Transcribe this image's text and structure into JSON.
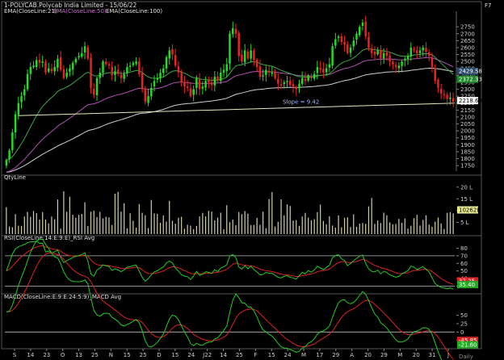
{
  "header": {
    "title": "1-POLYCAB.Polycab India Limited - 15/06/22",
    "ema_legend": [
      {
        "label": "EMA(CloseLine:21)",
        "color": "#e0e0e0"
      },
      {
        "label": "EMA(CloseLine:50)",
        "color": "#d070d0"
      },
      {
        "label": "EMA(CloseLine:100)",
        "color": "#e0e0e0"
      }
    ],
    "corner_label": "F7"
  },
  "colors": {
    "up": "#22dd22",
    "down": "#ee2222",
    "ema21": "#3aa84a",
    "ema50": "#b050b0",
    "ema100": "#cfcfcf",
    "rsi": "#22cc22",
    "rsi_avg": "#dd2222",
    "volume": "#cfcfaa"
  },
  "chart_data": [
    {
      "type": "candlestick",
      "title": "1-POLYCAB.Polycab India Limited - 15/06/22",
      "y_ticks": [
        2750,
        2700,
        2650,
        2600,
        2550,
        2500,
        2450,
        2400,
        2350,
        2300,
        2250,
        2200,
        2150,
        2100,
        2050,
        2000,
        1950,
        1900,
        1850,
        1800,
        1750
      ],
      "ylim": [
        1710,
        2815
      ],
      "x_tick_labels": [
        "S",
        "14",
        "23",
        "O",
        "13",
        "25",
        "N",
        "15",
        "25",
        "D",
        "15",
        "24",
        "J22",
        "14",
        "25",
        "F",
        "15",
        "24",
        "M",
        "17",
        "29",
        "A",
        "20",
        "29",
        "M",
        "20",
        "31",
        "J"
      ],
      "closes": [
        1790,
        1860,
        1990,
        2120,
        2200,
        2250,
        2300,
        2410,
        2460,
        2470,
        2510,
        2490,
        2500,
        2420,
        2450,
        2430,
        2460,
        2520,
        2440,
        2380,
        2420,
        2450,
        2490,
        2520,
        2540,
        2560,
        2610,
        2520,
        2310,
        2260,
        2380,
        2420,
        2500,
        2480,
        2470,
        2400,
        2430,
        2410,
        2380,
        2410,
        2460,
        2470,
        2490,
        2500,
        2410,
        2300,
        2210,
        2250,
        2310,
        2360,
        2380,
        2420,
        2450,
        2530,
        2580,
        2550,
        2470,
        2420,
        2350,
        2320,
        2310,
        2250,
        2300,
        2380,
        2300,
        2320,
        2360,
        2350,
        2330,
        2390,
        2360,
        2420,
        2440,
        2480,
        2700,
        2740,
        2700,
        2540,
        2500,
        2580,
        2520,
        2580,
        2510,
        2460,
        2390,
        2400,
        2440,
        2420,
        2420,
        2380,
        2340,
        2330,
        2350,
        2360,
        2330,
        2320,
        2300,
        2340,
        2380,
        2360,
        2400,
        2380,
        2410,
        2460,
        2440,
        2420,
        2450,
        2480,
        2610,
        2660,
        2680,
        2640,
        2620,
        2560,
        2600,
        2650,
        2700,
        2750,
        2780,
        2680,
        2600,
        2560,
        2550,
        2580,
        2520,
        2560,
        2540,
        2500,
        2480,
        2460,
        2470,
        2500,
        2520,
        2540,
        2600,
        2590,
        2560,
        2580,
        2600,
        2570,
        2540,
        2460,
        2360,
        2310,
        2270,
        2260,
        2230,
        2240,
        2210
      ],
      "volume_ticks": [
        "20 L",
        "15 L",
        "10 L",
        "5 L"
      ],
      "volume_last_label": "10262B",
      "volume_series_label": "QtyLine",
      "annotations": [
        {
          "text": "Slope = 9.42"
        },
        {
          "text": "2429.58",
          "series": "EMA(CloseLine:50)"
        },
        {
          "text": "2372.33",
          "series": "EMA(CloseLine:21)"
        },
        {
          "text": "2218.60",
          "series": "EMA(CloseLine:100)"
        }
      ]
    },
    {
      "type": "line",
      "title": "RSI(CloseLine:14:E:9:E)_RSI  Avg",
      "y_ticks": [
        80,
        70,
        60,
        50,
        40,
        30
      ],
      "ylim": [
        22,
        88
      ],
      "horizontal_levels": [
        70,
        30
      ],
      "series": [
        {
          "name": "RSI",
          "last_value_label": "37.25"
        },
        {
          "name": "Avg",
          "last_value_label": "35.40"
        }
      ]
    },
    {
      "type": "line",
      "title": "MACD(CloseLine:E:9:E:24:5:9)_MACD  Avg",
      "y_ticks": [
        50,
        25,
        0,
        -25
      ],
      "ylim": [
        -45,
        90
      ],
      "series": [
        {
          "name": "MACD",
          "last_value_label": "-45.85"
        },
        {
          "name": "Avg",
          "last_value_label": "-21.60"
        }
      ],
      "bottom_label": "Daily"
    }
  ]
}
